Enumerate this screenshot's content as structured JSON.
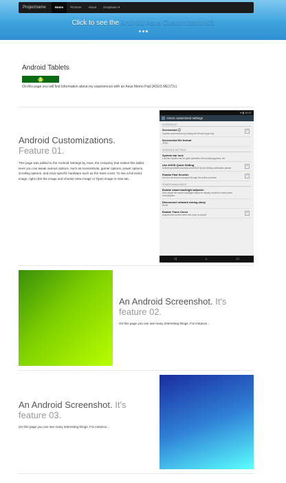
{
  "navbar": {
    "brand": "Projectname",
    "items": [
      {
        "label": "Home",
        "active": true
      },
      {
        "label": "Pictures",
        "active": false
      },
      {
        "label": "About",
        "active": false
      },
      {
        "label": "Dropdown ▾",
        "active": false
      }
    ]
  },
  "hero": {
    "caption_prefix": "Click to see the ",
    "caption_link": "Android Asus Customization03"
  },
  "tablets": {
    "title": "Android Tablets",
    "description": "On this page you will find information about my experiences with an Asus Memo Pad (ASUS ME172v)."
  },
  "feature1": {
    "heading": "Android Customizations.",
    "heading_muted": "Feature 01.",
    "text": "This page was added to the Android Settings by Asus, the company that makes this tablet. Here you can tweak various options, such as screenshots, gamer options, power options, scrolling options, and Asus specific hardware such as the trans cover. To see a full sized image, right click the image and choose View Image or Open image in new tab."
  },
  "phone": {
    "status": "▾ ▮ 10:37",
    "appbar_title": "ASUS customized settings",
    "sections": [
      {
        "header": "SCREENSHOT",
        "items": [
          {
            "title": "Screenshot ⓘ",
            "sub": "Capture screenshots by holding the Recent Apps Key",
            "checked": true
          },
          {
            "title": "Screenshot file format",
            "sub": "JPEG",
            "checked": false
          }
        ]
      },
      {
        "header": "INTERFACE SETTINGS",
        "items": [
          {
            "title": "System bar lock",
            "sub": "Lock the system bar for quiet operation when playing games, etc.",
            "checked": false
          },
          {
            "title": "Use ASUS Quick Setting",
            "sub": "Switching between Android and ASUS Quick Setting notification panels",
            "checked": true
          },
          {
            "title": "Enable Fast Scroller",
            "sub": "Use the scroll bar to browse through the online contents",
            "checked": true
          }
        ]
      },
      {
        "header": "POWER MANAGEMENT",
        "items": [
          {
            "title": "Enable smart backlight adjuster",
            "sub": "Auto adjust the screen backlight based on display content to save power consumption",
            "checked": false
          },
          {
            "title": "Disconnect network during sleep",
            "sub": "Never",
            "checked": false
          },
          {
            "title": "Enable Trans Cover",
            "sub": "Suspend the screen when the cover is closed",
            "checked": true
          }
        ]
      }
    ],
    "nav_icons": [
      "back-icon",
      "home-icon",
      "recents-icon"
    ]
  },
  "feature2": {
    "heading": "An Android Screenshot.",
    "heading_muted": "It's feature 02.",
    "text": "On this page you can see many interesting things. For instance..."
  },
  "feature3": {
    "heading": "An Android Screenshot.",
    "heading_muted": "It's feature 03.",
    "text": "On this page you can see many interesting things. For instance..."
  },
  "colors": {
    "navbar_bg": "#1b1b1b",
    "hero_bg": "#3fa4de",
    "banner_bg": "#0a6b12",
    "green_gradient": [
      "#3a8f0a",
      "#b8ff00"
    ],
    "blue_gradient": [
      "#1a2d9c",
      "#5bffff"
    ]
  }
}
